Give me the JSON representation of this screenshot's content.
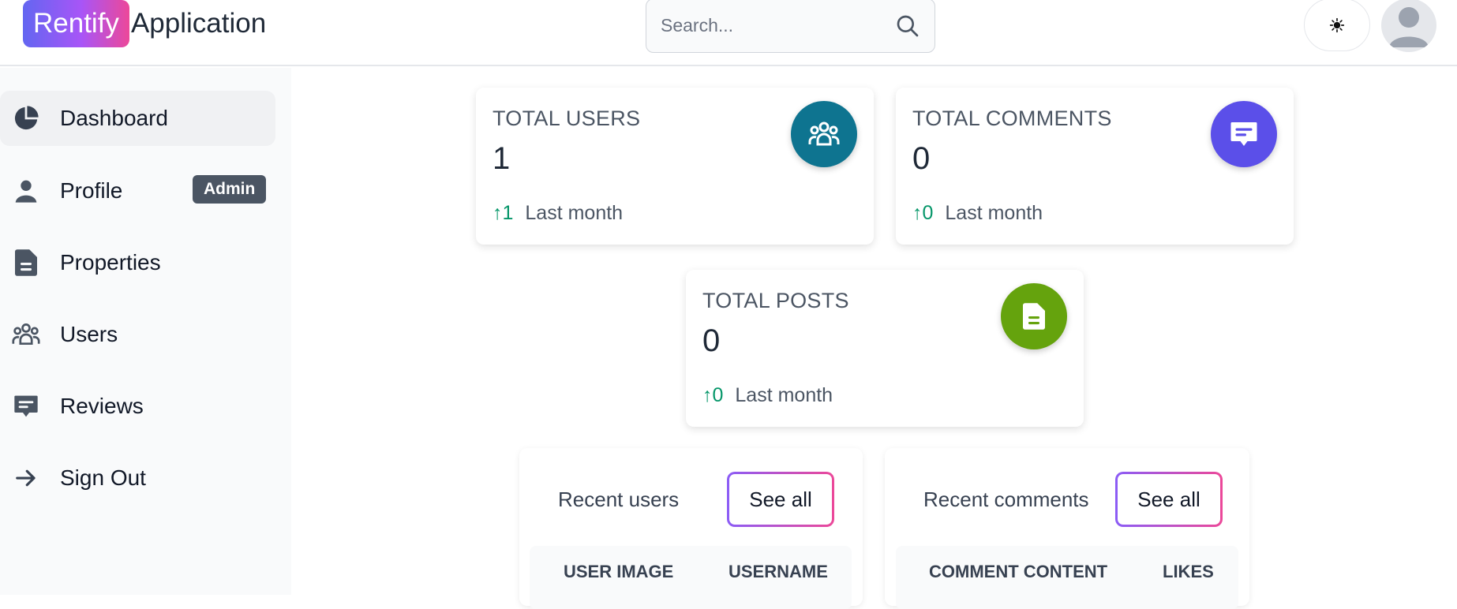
{
  "brand": {
    "pill": "Rentify",
    "text": "Application"
  },
  "search": {
    "placeholder": "Search..."
  },
  "sidebar": {
    "items": [
      {
        "label": "Dashboard",
        "icon": "pie-chart-icon",
        "active": true
      },
      {
        "label": "Profile",
        "icon": "user-icon",
        "badge": "Admin"
      },
      {
        "label": "Properties",
        "icon": "document-icon"
      },
      {
        "label": "Users",
        "icon": "users-group-icon"
      },
      {
        "label": "Reviews",
        "icon": "message-icon"
      },
      {
        "label": "Sign Out",
        "icon": "arrow-right-icon"
      }
    ]
  },
  "stats": {
    "users": {
      "title": "TOTAL USERS",
      "value": "1",
      "trend_value": "1",
      "trend_text": "Last month",
      "icon": "users-group-icon",
      "color": "#0e7490"
    },
    "comments": {
      "title": "TOTAL COMMENTS",
      "value": "0",
      "trend_value": "0",
      "trend_text": "Last month",
      "icon": "message-icon",
      "color": "#5b4fe9"
    },
    "posts": {
      "title": "TOTAL POSTS",
      "value": "0",
      "trend_value": "0",
      "trend_text": "Last month",
      "icon": "document-icon",
      "color": "#65a30d"
    }
  },
  "recent_users": {
    "title": "Recent users",
    "see_all": "See all",
    "columns": [
      "USER IMAGE",
      "USERNAME"
    ]
  },
  "recent_comments": {
    "title": "Recent comments",
    "see_all": "See all",
    "columns": [
      "COMMENT CONTENT",
      "LIKES"
    ]
  }
}
